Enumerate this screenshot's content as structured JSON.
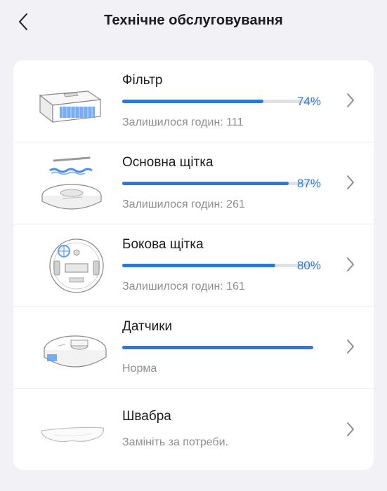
{
  "header": {
    "title": "Технічне обслуговування",
    "back_icon": "chevron-left-icon"
  },
  "colors": {
    "accent": "#2a78d7",
    "track": "#e1e1e6",
    "background": "#f2f2f6",
    "secondary_text": "#8e8e93"
  },
  "items": [
    {
      "name": "Фільтр",
      "progress": 0.74,
      "percent": "74%",
      "subtitle": "Залишилося годин: 111",
      "icon": "filter-icon"
    },
    {
      "name": "Основна щітка",
      "progress": 0.87,
      "percent": "87%",
      "subtitle": "Залишилося годин: 261",
      "icon": "main-brush-icon"
    },
    {
      "name": "Бокова щітка",
      "progress": 0.8,
      "percent": "80%",
      "subtitle": "Залишилося годин: 161",
      "icon": "side-brush-icon"
    },
    {
      "name": "Датчики",
      "progress": 1.0,
      "percent": "",
      "subtitle": "Норма",
      "icon": "sensors-icon"
    },
    {
      "name": "Швабра",
      "progress": null,
      "percent": "",
      "subtitle": "Замініть за потреби.",
      "icon": "mop-icon"
    }
  ]
}
